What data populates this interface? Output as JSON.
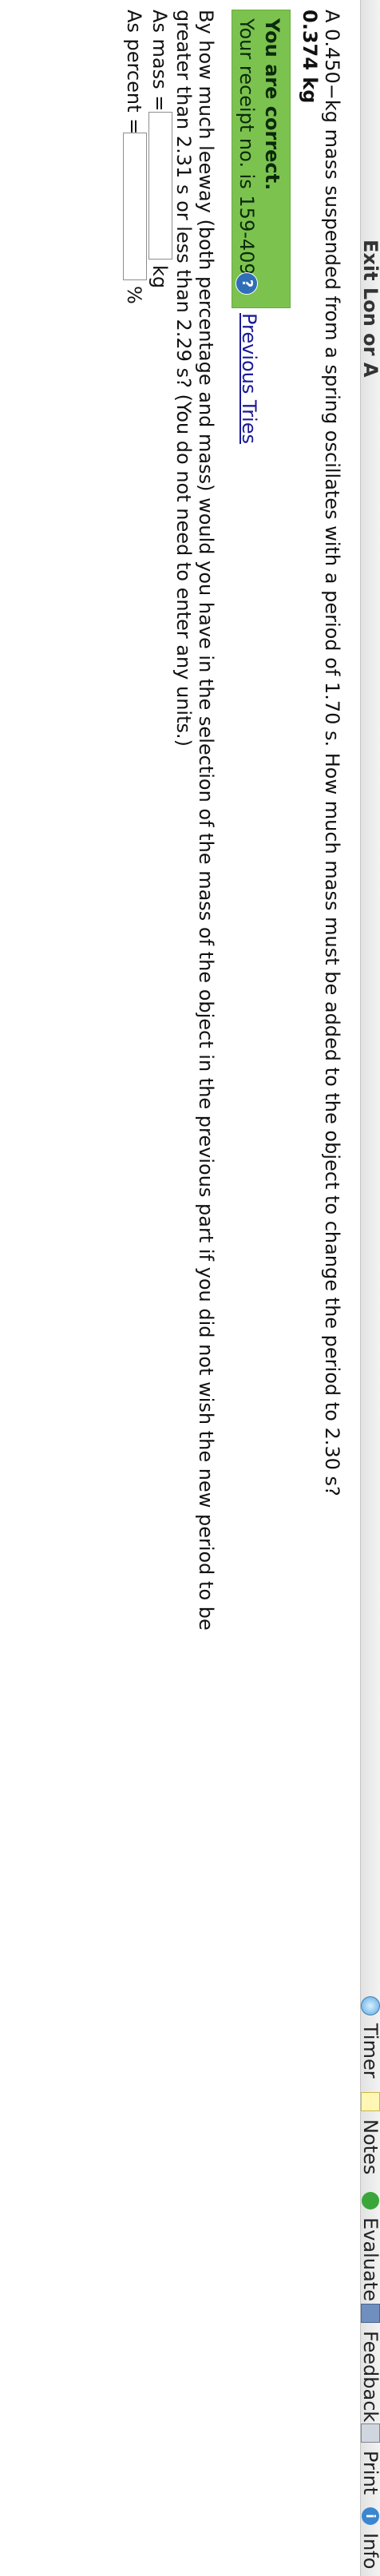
{
  "toolbar": {
    "title": "Exit Lon or A",
    "timer_label": "Timer",
    "notes_label": "Notes",
    "evaluate_label": "Evaluate",
    "feedback_label": "Feedback",
    "print_label": "Print",
    "info_label": "Info"
  },
  "part1": {
    "question": "A 0.450−kg mass suspended from a spring oscillates with a period of 1.70 s. How much mass must be added to the object to change the period to 2.30 s?",
    "answer": "0.374 kg"
  },
  "feedback": {
    "status": "You are correct.",
    "receipt": "Your receipt no. is 159-4092",
    "help_glyph": "?",
    "previous_tries": "Previous Tries"
  },
  "part2": {
    "question_line1": "By how much leeway (both percentage and mass) would you have in the selection of the mass of the object in the previous part if you did not wish the new period to be",
    "question_line2": "greater than 2.31 s or less than 2.29 s? (You do not need to enter any units.)",
    "mass_label": "As mass =",
    "mass_value": "",
    "mass_unit": "kg",
    "percent_label": "As percent =",
    "percent_value": "",
    "percent_unit": "%"
  }
}
